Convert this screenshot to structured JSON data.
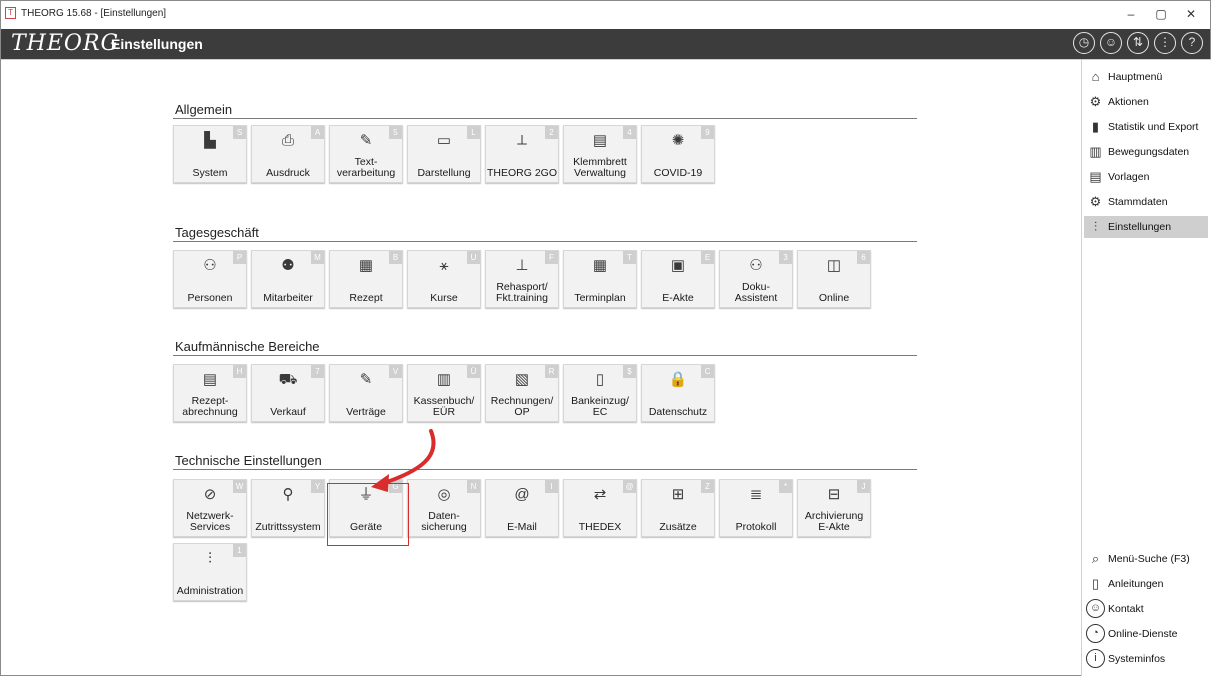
{
  "window": {
    "title": "THEORG 15.68 - [Einstellungen]",
    "minimize": "–",
    "maximize": "▢",
    "close": "✕"
  },
  "header": {
    "logo": "THEORG",
    "title": "Einstellungen",
    "icons": [
      "history-icon",
      "support-person-icon",
      "remote-icon",
      "menu-dots-icon",
      "help-icon"
    ]
  },
  "sections": [
    {
      "title": "Allgemein",
      "tiles": [
        {
          "label": "System",
          "key": "S",
          "icon": "computer-icon"
        },
        {
          "label": "Ausdruck",
          "key": "A",
          "icon": "printer-icon"
        },
        {
          "label": "Text-\nverarbeitung",
          "key": "5",
          "icon": "pen-paper-icon"
        },
        {
          "label": "Darstellung",
          "key": "L",
          "icon": "monitor-icon"
        },
        {
          "label": "THEORG 2GO",
          "key": "2",
          "icon": "2go-icon"
        },
        {
          "label": "Klemmbrett\nVerwaltung",
          "key": "4",
          "icon": "clipboard-icon"
        },
        {
          "label": "COVID-19",
          "key": "9",
          "icon": "virus-icon"
        }
      ]
    },
    {
      "title": "Tagesgeschäft",
      "tiles": [
        {
          "label": "Personen",
          "key": "P",
          "icon": "persons-icon"
        },
        {
          "label": "Mitarbeiter",
          "key": "M",
          "icon": "staff-icon"
        },
        {
          "label": "Rezept",
          "key": "B",
          "icon": "prescription-icon"
        },
        {
          "label": "Kurse",
          "key": "U",
          "icon": "course-icon"
        },
        {
          "label": "Rehasport/\nFkt.training",
          "key": "F",
          "icon": "rehasport-icon"
        },
        {
          "label": "Terminplan",
          "key": "T",
          "icon": "calendar-icon"
        },
        {
          "label": "E-Akte",
          "key": "E",
          "icon": "e-file-icon"
        },
        {
          "label": "Doku-\nAssistent",
          "key": "3",
          "icon": "doc-assistant-icon"
        },
        {
          "label": "Online",
          "key": "6",
          "icon": "online-calendar-icon"
        }
      ]
    },
    {
      "title": "Kaufmännische Bereiche",
      "tiles": [
        {
          "label": "Rezept-\nabrechnung",
          "key": "H",
          "icon": "billing-icon"
        },
        {
          "label": "Verkauf",
          "key": "7",
          "icon": "cart-icon"
        },
        {
          "label": "Verträge",
          "key": "V",
          "icon": "contract-icon"
        },
        {
          "label": "Kassenbuch/\nEÜR",
          "key": "Ü",
          "icon": "cashbook-icon"
        },
        {
          "label": "Rechnungen/\nOP",
          "key": "R",
          "icon": "invoice-icon"
        },
        {
          "label": "Bankeinzug/\nEC",
          "key": "$",
          "icon": "bank-icon"
        },
        {
          "label": "Datenschutz",
          "key": "C",
          "icon": "lock-icon"
        }
      ]
    },
    {
      "title": "Technische Einstellungen",
      "tiles": [
        {
          "label": "Netzwerk-\nServices",
          "key": "W",
          "icon": "network-icon"
        },
        {
          "label": "Zutrittssystem",
          "key": "Y",
          "icon": "access-icon"
        },
        {
          "label": "Geräte",
          "key": "G",
          "icon": "device-icon"
        },
        {
          "label": "Daten-\nsicherung",
          "key": "N",
          "icon": "backup-icon"
        },
        {
          "label": "E-Mail",
          "key": "I",
          "icon": "at-icon"
        },
        {
          "label": "THEDEX",
          "key": "@",
          "icon": "thedex-icon"
        },
        {
          "label": "Zusätze",
          "key": "Z",
          "icon": "addons-icon"
        },
        {
          "label": "Protokoll",
          "key": "*",
          "icon": "log-icon"
        },
        {
          "label": "Archivierung\nE-Akte",
          "key": "J",
          "icon": "archive-icon"
        },
        {
          "label": "Administration",
          "key": "1",
          "icon": "admin-icon"
        }
      ]
    }
  ],
  "sidebar": {
    "top": [
      {
        "label": "Hauptmenü",
        "icon": "home-icon",
        "active": false
      },
      {
        "label": "Aktionen",
        "icon": "gears-icon",
        "active": false
      },
      {
        "label": "Statistik und Export",
        "icon": "bar-chart-icon",
        "active": false
      },
      {
        "label": "Bewegungsdaten",
        "icon": "movement-data-icon",
        "active": false
      },
      {
        "label": "Vorlagen",
        "icon": "template-icon",
        "active": false
      },
      {
        "label": "Stammdaten",
        "icon": "master-data-icon",
        "active": false
      },
      {
        "label": "Einstellungen",
        "icon": "settings-sliders-icon",
        "active": true
      }
    ],
    "bottom": [
      {
        "label": "Menü-Suche (F3)",
        "icon": "search-icon"
      },
      {
        "label": "Anleitungen",
        "icon": "manual-icon"
      },
      {
        "label": "Kontakt",
        "icon": "contact-icon"
      },
      {
        "label": "Online-Dienste",
        "icon": "online-services-icon"
      },
      {
        "label": "Systeminfos",
        "icon": "info-icon"
      }
    ]
  },
  "colors": {
    "header_bg": "#3c3c3c",
    "highlight": "#d92c2c",
    "active_sidebar": "#cfcfcf",
    "tile_bg": "#f2f2f2"
  }
}
